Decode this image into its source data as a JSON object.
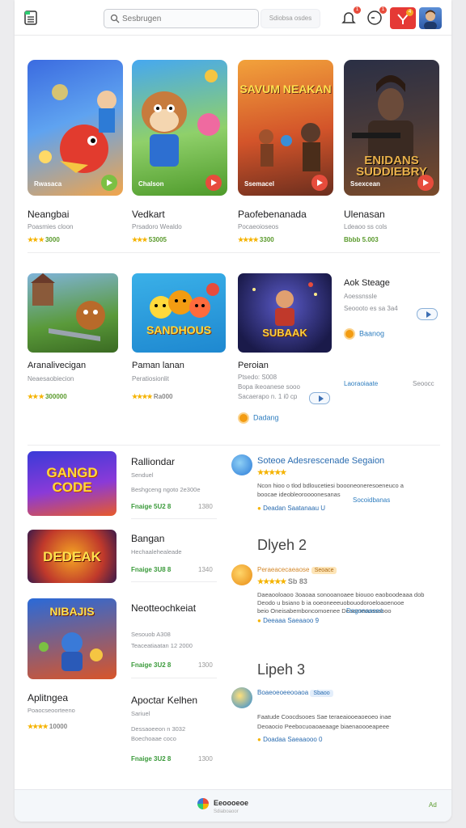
{
  "header": {
    "search_placeholder": "Sesbrugen",
    "search_button": "Sdiobsa osdes",
    "notif_badge_1": "1",
    "notif_badge_2": "1",
    "red_badge": "4"
  },
  "featured": [
    {
      "caption": "Rwasaca",
      "title": "Neangbai",
      "sub": "Poasmies cloon",
      "rating": "3000"
    },
    {
      "caption": "Chalson",
      "title": "Vedkart",
      "sub": "Prsadoro Wealdo",
      "rating": "53005"
    },
    {
      "caption": "Ssemacel",
      "title": "Paofebenanada",
      "sub": "Pocaeoioseos",
      "rating": "3300"
    },
    {
      "caption": "Ssexcean",
      "title": "Ulenasan",
      "sub": "Ldeaoo ss cols",
      "rating": "Bbbb 5.003"
    }
  ],
  "featured_art": [
    "",
    "",
    "SAVUM NEAKAN",
    "ENIDANS SUDDIEBRY"
  ],
  "grid": [
    {
      "title": "Aranalivecigan",
      "sub": "Neaesaobiecion",
      "rating": "300000"
    },
    {
      "title": "Paman lanan",
      "sub": "Peratiosionlit",
      "rating": "Ra000",
      "art": "SANDHOUS"
    },
    {
      "title": "Peroian",
      "sub_lines": [
        "Ptsedo: S008",
        "Bopa ikeoanese sooo",
        "Sacaerapo n. 1 i0 cp"
      ],
      "badge": "Dadang",
      "art": "SUBAAK"
    },
    {
      "title": "Aok Steage",
      "sub_lines": [
        "Aoessnssle",
        "Seoooto es sa 3a4"
      ],
      "badge": "Baanog",
      "extra_left": "Laoraoiaate",
      "extra_right": "Seoocc"
    }
  ],
  "list": [
    {
      "art": "GANGD CODE",
      "title": "Ralliondar",
      "sub1": "Senduel",
      "sub2": "Beshgceng ngoto  2e300e",
      "meta": "Fnaige  5U2 8",
      "num": "1380"
    },
    {
      "art": "DEDEAK",
      "title": "Bangan",
      "sub1": "Hechaalehealeade",
      "sub2": "",
      "meta": "Fnaige  3U8 8",
      "num": "1340"
    },
    {
      "art": "NIBAJIS",
      "title": "Neotteochkeiat",
      "sub1": "Sesouob A308",
      "sub2": "Teaceatiaatan 12 2000",
      "meta": "Fnaige  3U2 8",
      "num": "1300"
    },
    {
      "art": "",
      "title": "Aplitngea",
      "sub1": "Poaocseoorteeno",
      "rating": "10000"
    },
    {
      "art": "",
      "title": "Apoctar Kelhen",
      "sub1": "Sariuel",
      "sub2": "Dessaoeeon n 3032",
      "sub3": "Boechoaae coco",
      "meta": "Fnaige  3U2 8",
      "num": "1300"
    }
  ],
  "reviews": [
    {
      "title": "Soteoe Adesrescenade Segaion",
      "stars": "★★★★★",
      "text": [
        "Ncon hioo o tlod bdloucetiesi boooneoneresoeneuco a",
        "boocae ideobleoroooonesanas"
      ],
      "link": "Socoidbanas",
      "foot": "Deadan Saatanaau  U"
    },
    {
      "heading": "Dlyeh 2"
    },
    {
      "title": "Peraeacecaeaose",
      "tag": "Seoace",
      "stars": "★★★★★",
      "score": "Sb 83",
      "text": [
        "Daeaooloaoo 3oaoaa sonooanoaee biouoo eaoboodeaaa dob",
        "Deodo u bsiano b ia ooeoneeeuobouodoroeloaoenooe",
        "beio Oneisabemboncomoenee Deoomeooasoboo"
      ],
      "link": "Dogonaaseo",
      "foot": "Deeaaa Saeaaoo  9"
    },
    {
      "heading": "Lipeh 3"
    },
    {
      "title": "Boaeoeoeeooaoa",
      "tag": "Sbaoo",
      "text": [
        "Faatude Coocdsooes Sae teraeaiooeaoeoeo inae",
        "Deoaocio Peebocuoaoaeaage biaenaoooeapeee"
      ],
      "foot": "Doadaa Saeaaooo  0"
    }
  ],
  "bottom": {
    "label": "Eeoooeoe",
    "sub": "Sdiaboaoor",
    "right": "Ad"
  }
}
